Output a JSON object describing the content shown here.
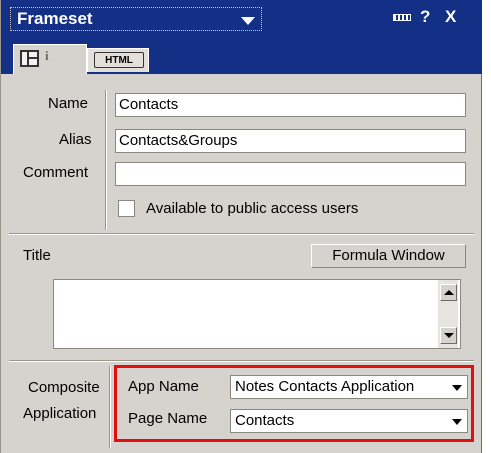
{
  "header": {
    "title": "Frameset",
    "icons": [
      "dropdown-arrow-icon",
      "minimize-icon",
      "help-icon",
      "close-icon"
    ],
    "help_label": "?",
    "close_label": "X"
  },
  "tabs": {
    "active_icons": [
      "frameset-icon",
      "info-icon"
    ],
    "info_glyph": "i",
    "html_label": "HTML"
  },
  "form": {
    "name_label": "Name",
    "name_value": "Contacts",
    "alias_label": "Alias",
    "alias_value": "Contacts&Groups",
    "comment_label": "Comment",
    "comment_value": "",
    "public_access_label": "Available to public access users",
    "public_access_checked": false,
    "title_label": "Title",
    "formula_window_label": "Formula Window",
    "title_formula_value": ""
  },
  "composite": {
    "label_line1": "Composite",
    "label_line2": "Application",
    "app_name_label": "App Name",
    "app_name_value": "Notes Contacts Application",
    "page_name_label": "Page Name",
    "page_name_value": "Contacts",
    "highlight_color": "#e01010"
  },
  "colors": {
    "titlebar": "#142f86",
    "panel": "#d6d3ce"
  }
}
